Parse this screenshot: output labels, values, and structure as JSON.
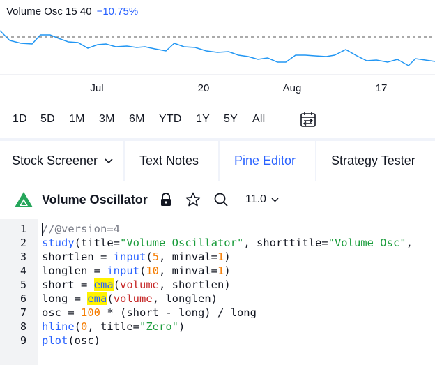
{
  "chart": {
    "indicator_name": "Volume Osc 15 40",
    "indicator_value": "−10.75%",
    "line_color": "#2196f3",
    "x_ticks": [
      "Jul",
      "20",
      "Aug",
      "17"
    ]
  },
  "range_bar": {
    "buttons": [
      "1D",
      "5D",
      "1M",
      "3M",
      "6M",
      "YTD",
      "1Y",
      "5Y",
      "All"
    ],
    "compare_icon": "calendar-compare-icon"
  },
  "tabs": {
    "items": [
      "Stock Screener",
      "Text Notes",
      "Pine Editor",
      "Strategy Tester"
    ],
    "active": "Pine Editor",
    "active_color": "#2962ff"
  },
  "editor": {
    "script_name": "Volume Oscillator",
    "version": "11.0",
    "icons": [
      "lock-icon",
      "star-icon",
      "search-icon"
    ]
  },
  "code": {
    "lines": [
      [
        [
          "comment",
          "//@version=4"
        ]
      ],
      [
        [
          "kw",
          "study"
        ],
        [
          "op",
          "(title="
        ],
        [
          "str",
          "\"Volume Oscillator\""
        ],
        [
          "op",
          ", shorttitle="
        ],
        [
          "str",
          "\"Volume Osc\""
        ],
        [
          "op",
          ","
        ]
      ],
      [
        [
          "plain",
          "shortlen "
        ],
        [
          "op",
          "= "
        ],
        [
          "kw",
          "input"
        ],
        [
          "op",
          "("
        ],
        [
          "num",
          "5"
        ],
        [
          "op",
          ", minval="
        ],
        [
          "num",
          "1"
        ],
        [
          "op",
          ")"
        ]
      ],
      [
        [
          "plain",
          "longlen "
        ],
        [
          "op",
          "= "
        ],
        [
          "kw",
          "input"
        ],
        [
          "op",
          "("
        ],
        [
          "num",
          "10"
        ],
        [
          "op",
          ", minval="
        ],
        [
          "num",
          "1"
        ],
        [
          "op",
          ")"
        ]
      ],
      [
        [
          "plain",
          "short "
        ],
        [
          "op",
          "= "
        ],
        [
          "kwhl",
          "ema"
        ],
        [
          "op",
          "("
        ],
        [
          "var",
          "volume"
        ],
        [
          "op",
          ", shortlen)"
        ]
      ],
      [
        [
          "plain",
          "long "
        ],
        [
          "op",
          "= "
        ],
        [
          "kwhl",
          "ema"
        ],
        [
          "op",
          "("
        ],
        [
          "var",
          "volume"
        ],
        [
          "op",
          ", longlen)"
        ]
      ],
      [
        [
          "plain",
          "osc "
        ],
        [
          "op",
          "= "
        ],
        [
          "num",
          "100"
        ],
        [
          "op",
          " * (short - long) / long"
        ]
      ],
      [
        [
          "kw",
          "hline"
        ],
        [
          "op",
          "("
        ],
        [
          "num",
          "0"
        ],
        [
          "op",
          ", title="
        ],
        [
          "str",
          "\"Zero\""
        ],
        [
          "op",
          ")"
        ]
      ],
      [
        [
          "kw",
          "plot"
        ],
        [
          "op",
          "(osc)"
        ]
      ]
    ]
  }
}
